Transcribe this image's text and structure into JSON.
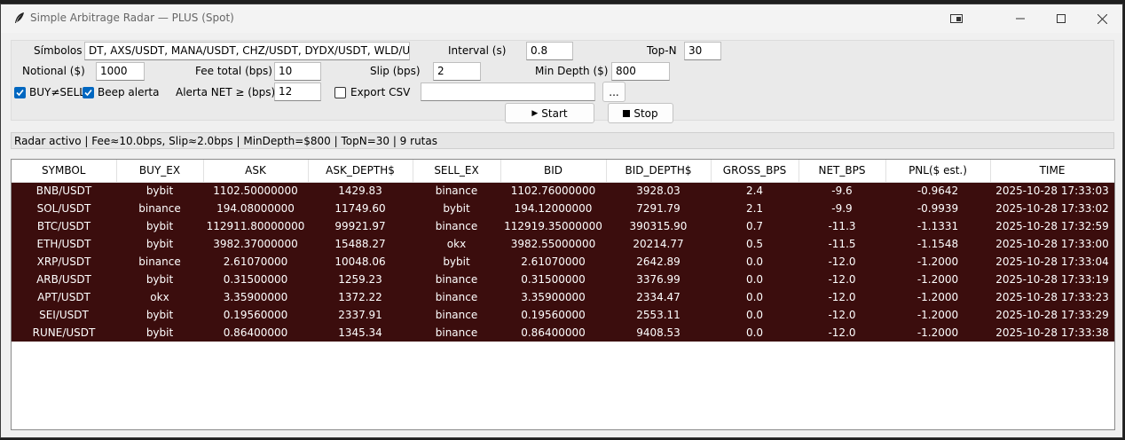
{
  "window": {
    "title": "Simple Arbitrage Radar — PLUS (Spot)"
  },
  "controls": {
    "symbols_label": "Símbolos",
    "symbols_value": "DT, AXS/USDT, MANA/USDT, CHZ/USDT, DYDX/USDT, WLD/USDT, F",
    "interval_label": "Interval (s)",
    "interval_value": "0.8",
    "topn_label": "Top-N",
    "topn_value": "30",
    "notional_label": "Notional ($)",
    "notional_value": "1000",
    "fee_label": "Fee total (bps)",
    "fee_value": "10",
    "slip_label": "Slip (bps)",
    "slip_value": "2",
    "mindepth_label": "Min Depth ($)",
    "mindepth_value": "800",
    "buy_sell_label": "BUY≠SELL",
    "buy_sell_checked": true,
    "beep_label": "Beep alerta",
    "beep_checked": true,
    "alert_label": "Alerta NET ≥ (bps)",
    "alert_value": "12",
    "export_label": "Export CSV",
    "export_checked": false,
    "export_path": "",
    "browse_label": "...",
    "start_label": "Start",
    "stop_label": "Stop"
  },
  "status_text": "Radar activo | Fee≈10.0bps, Slip≈2.0bps | MinDepth=$800 | TopN=30 | 9 rutas",
  "table": {
    "columns": [
      "SYMBOL",
      "BUY_EX",
      "ASK",
      "ASK_DEPTH$",
      "SELL_EX",
      "BID",
      "BID_DEPTH$",
      "GROSS_BPS",
      "NET_BPS",
      "PNL($ est.)",
      "TIME"
    ],
    "rows": [
      [
        "BNB/USDT",
        "bybit",
        "1102.50000000",
        "1429.83",
        "binance",
        "1102.76000000",
        "3928.03",
        "2.4",
        "-9.6",
        "-0.9642",
        "2025-10-28 17:33:03"
      ],
      [
        "SOL/USDT",
        "binance",
        "194.08000000",
        "11749.60",
        "bybit",
        "194.12000000",
        "7291.79",
        "2.1",
        "-9.9",
        "-0.9939",
        "2025-10-28 17:33:02"
      ],
      [
        "BTC/USDT",
        "bybit",
        "112911.80000000",
        "99921.97",
        "binance",
        "112919.35000000",
        "390315.90",
        "0.7",
        "-11.3",
        "-1.1331",
        "2025-10-28 17:32:59"
      ],
      [
        "ETH/USDT",
        "bybit",
        "3982.37000000",
        "15488.27",
        "okx",
        "3982.55000000",
        "20214.77",
        "0.5",
        "-11.5",
        "-1.1548",
        "2025-10-28 17:33:00"
      ],
      [
        "XRP/USDT",
        "binance",
        "2.61070000",
        "10048.06",
        "bybit",
        "2.61070000",
        "2642.89",
        "0.0",
        "-12.0",
        "-1.2000",
        "2025-10-28 17:33:04"
      ],
      [
        "ARB/USDT",
        "bybit",
        "0.31500000",
        "1259.23",
        "binance",
        "0.31500000",
        "3376.99",
        "0.0",
        "-12.0",
        "-1.2000",
        "2025-10-28 17:33:19"
      ],
      [
        "APT/USDT",
        "okx",
        "3.35900000",
        "1372.22",
        "binance",
        "3.35900000",
        "2334.47",
        "0.0",
        "-12.0",
        "-1.2000",
        "2025-10-28 17:33:23"
      ],
      [
        "SEI/USDT",
        "bybit",
        "0.19560000",
        "2337.91",
        "binance",
        "0.19560000",
        "2553.11",
        "0.0",
        "-12.0",
        "-1.2000",
        "2025-10-28 17:33:29"
      ],
      [
        "RUNE/USDT",
        "bybit",
        "0.86400000",
        "1345.34",
        "binance",
        "0.86400000",
        "9408.53",
        "0.0",
        "-12.0",
        "-1.2000",
        "2025-10-28 17:33:38"
      ]
    ]
  },
  "colors": {
    "row_bg": "#3b0d0d",
    "accent": "#0067c0"
  },
  "icons": {
    "app": "feather-icon",
    "start": "play-icon",
    "stop": "stop-icon"
  }
}
